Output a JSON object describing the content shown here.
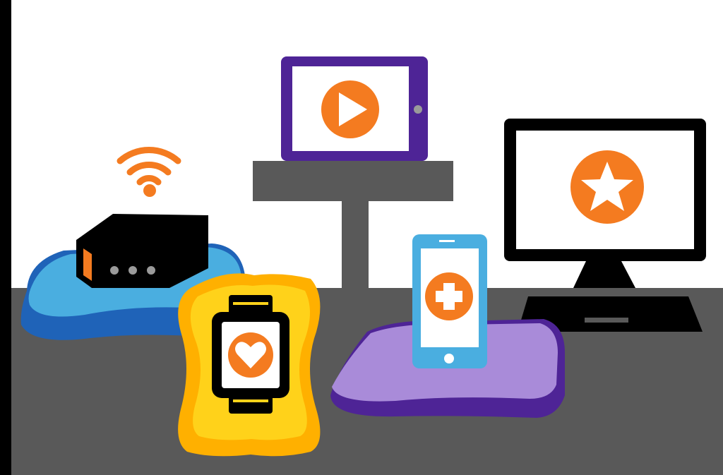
{
  "scene": {
    "description_icons": [
      "wifi-icon",
      "play-icon",
      "star-icon",
      "heart-icon",
      "plus-icon"
    ],
    "colors": {
      "frame": "#000000",
      "wall": "#ffffff",
      "floor": "#595959",
      "shelf": "#595959",
      "accent_orange": "#f47b20",
      "tablet_purple": "#4e2496",
      "router_cushion_light": "#4aaee0",
      "router_cushion_dark": "#1f63b8",
      "watch_cushion_outer": "#ffb000",
      "watch_cushion_inner": "#ffd21a",
      "phone_blue": "#4aaee0",
      "phone_cushion_light": "#a98bd9",
      "phone_cushion_dark": "#4e2496",
      "device_black": "#000000",
      "router_dots": "#9a9a9a"
    }
  }
}
